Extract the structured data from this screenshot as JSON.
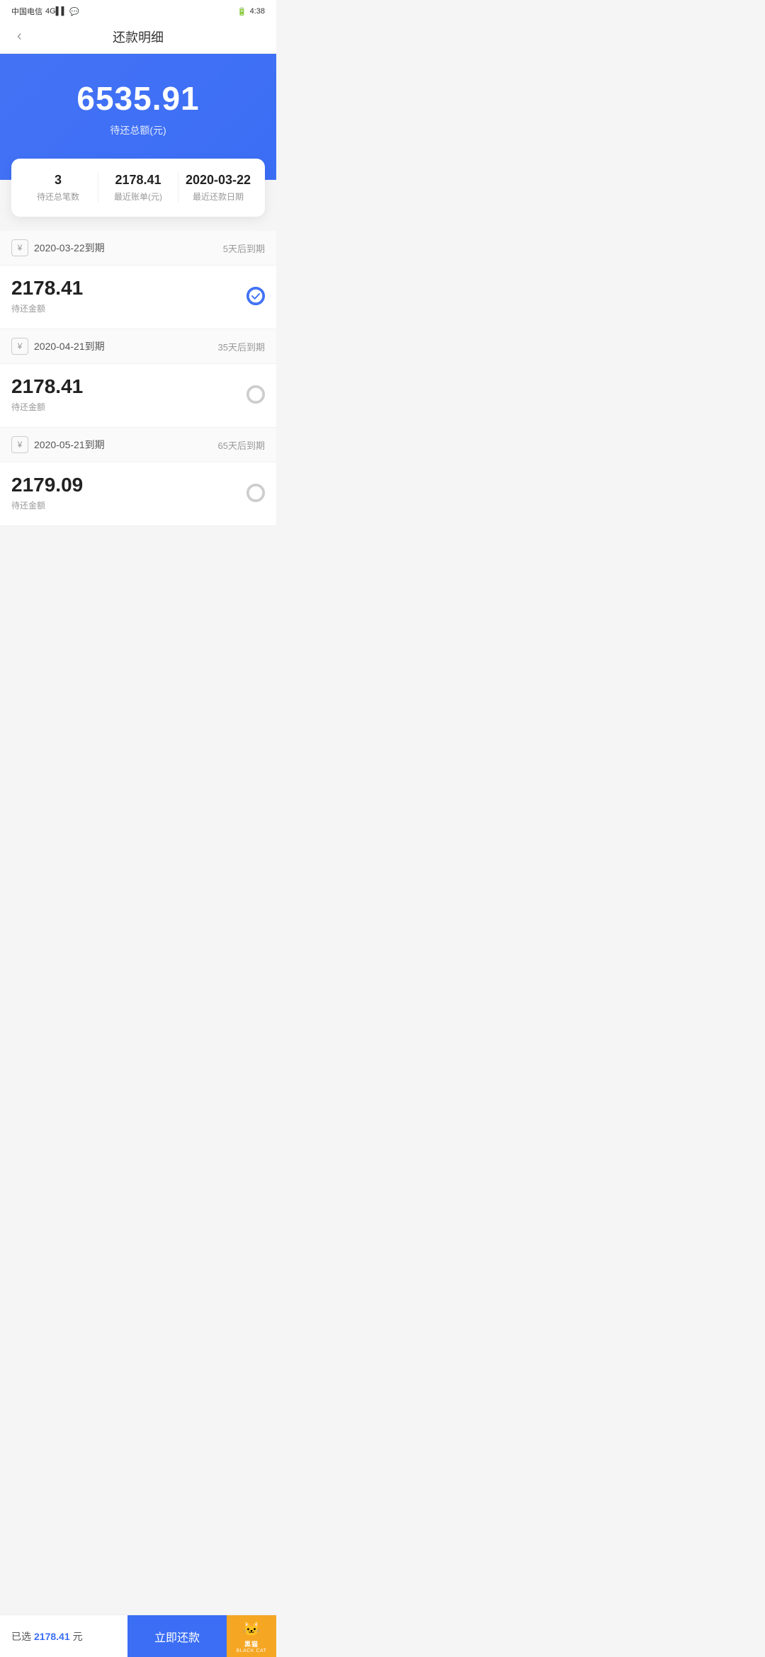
{
  "statusBar": {
    "carrier": "中国电信",
    "signal": "4G",
    "time": "4:38"
  },
  "navBar": {
    "title": "还款明细",
    "backLabel": "‹"
  },
  "hero": {
    "amount": "6535.91",
    "label": "待还总额(元)"
  },
  "summaryCard": {
    "items": [
      {
        "value": "3",
        "desc": "待还总笔数"
      },
      {
        "value": "2178.41",
        "desc": "最近账单(元)"
      },
      {
        "value": "2020-03-22",
        "desc": "最近还款日期"
      }
    ]
  },
  "paymentList": [
    {
      "dueDate": "2020-03-22到期",
      "dueDays": "5天后到期",
      "amount": "2178.41",
      "amountLabel": "待还金额",
      "selected": true
    },
    {
      "dueDate": "2020-04-21到期",
      "dueDays": "35天后到期",
      "amount": "2178.41",
      "amountLabel": "待还金额",
      "selected": false
    },
    {
      "dueDate": "2020-05-21到期",
      "dueDays": "65天后到期",
      "amount": "2179.09",
      "amountLabel": "待还金额",
      "selected": false
    }
  ],
  "bottomBar": {
    "selectedPrefix": "已选",
    "selectedAmount": "2178.41",
    "selectedSuffix": "元",
    "payButtonLabel": "立即还款"
  },
  "blackCat": {
    "label": "黑猫",
    "subLabel": "BLACK CAT"
  }
}
